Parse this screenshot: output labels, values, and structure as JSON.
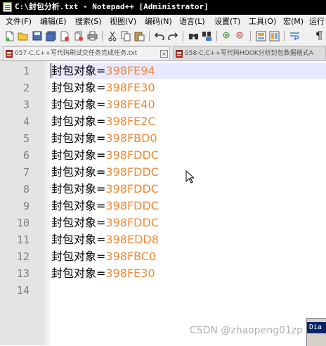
{
  "window": {
    "title": "C:\\封包分析.txt - Notepad++ [Administrator]"
  },
  "menu": [
    "文件(F)",
    "编辑(E)",
    "搜索(S)",
    "视图(V)",
    "编码(N)",
    "语言(L)",
    "设置(T)",
    "工具(O)",
    "宏(M)",
    "运行"
  ],
  "toolbar": {
    "icons": [
      "new-file-icon",
      "open-file-icon",
      "save-icon",
      "save-all-icon",
      "close-icon",
      "close-all-icon",
      "print-icon",
      "cut-icon",
      "copy-icon",
      "paste-icon",
      "undo-icon",
      "redo-icon",
      "find-icon",
      "replace-icon",
      "zoom-in-icon",
      "zoom-out-icon",
      "sync-v-icon",
      "sync-h-icon",
      "word-wrap-icon",
      "show-all-chars-icon"
    ]
  },
  "tabs": [
    {
      "label": "057-C,C++写代码刷试交任务完成任务.txt",
      "active": true
    },
    {
      "label": "058-C,C++写代码HOOK分析封包数据格式A",
      "active": false
    }
  ],
  "editor": {
    "lines": [
      {
        "num": "1",
        "label": "封包对象",
        "eq": "=",
        "value": "398FE94"
      },
      {
        "num": "2",
        "label": "封包对象",
        "eq": "=",
        "value": "398FE30"
      },
      {
        "num": "3",
        "label": "封包对象",
        "eq": "=",
        "value": "398FE40"
      },
      {
        "num": "4",
        "label": "封包对象",
        "eq": "=",
        "value": "398FE2C"
      },
      {
        "num": "5",
        "label": "封包对象",
        "eq": "=",
        "value": "398FBD0"
      },
      {
        "num": "6",
        "label": "封包对象",
        "eq": "=",
        "value": "398FDDC"
      },
      {
        "num": "7",
        "label": "封包对象",
        "eq": "=",
        "value": "398FDDC"
      },
      {
        "num": "8",
        "label": "封包对象",
        "eq": "=",
        "value": "398FDDC"
      },
      {
        "num": "9",
        "label": "封包对象",
        "eq": "=",
        "value": "398FDDC"
      },
      {
        "num": "10",
        "label": "封包对象",
        "eq": "=",
        "value": "398FDDC"
      },
      {
        "num": "11",
        "label": "封包对象",
        "eq": "=",
        "value": "398EDD8"
      },
      {
        "num": "12",
        "label": "封包对象",
        "eq": "=",
        "value": "398FBC0"
      },
      {
        "num": "13",
        "label": "封包对象",
        "eq": "=",
        "value": "398FE30"
      },
      {
        "num": "14",
        "label": "",
        "eq": "",
        "value": ""
      }
    ]
  },
  "watermark": "CSDN @zhaopeng01zp",
  "dialog": {
    "title_fragment": "Dia"
  },
  "colors": {
    "value_orange": "#ef8a36",
    "caret_line": "#e8e8ff",
    "gutter": "#e4e4e4"
  }
}
